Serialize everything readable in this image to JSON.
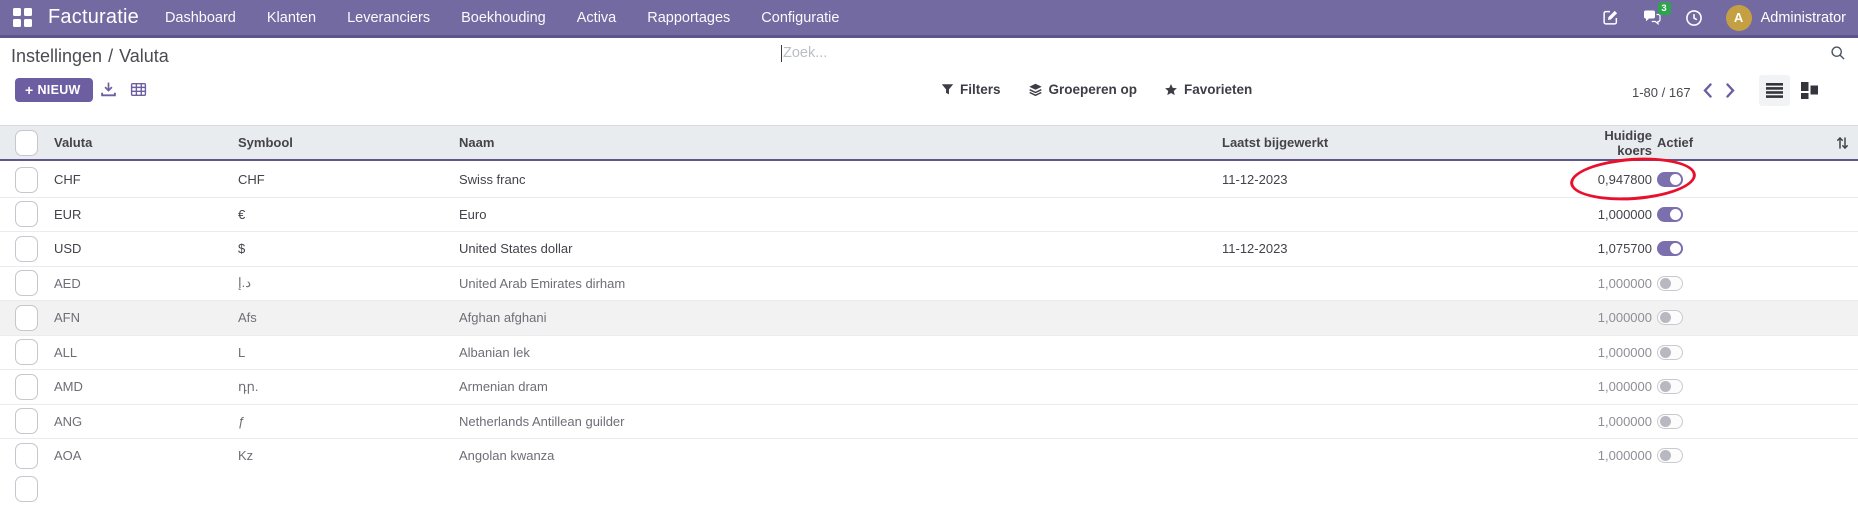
{
  "colors": {
    "navbar_bg": "#726AA1",
    "accent_purple": "#6D5EA2",
    "toggle_on_purple": "#7B6FAE",
    "badge_green": "#2EA44F",
    "avatar_gold": "#C5A042",
    "annotation_red": "#E8112D",
    "header_row_bg": "#E9ECEF"
  },
  "navbar": {
    "app_name": "Facturatie",
    "menu_items": [
      "Dashboard",
      "Klanten",
      "Leveranciers",
      "Boekhouding",
      "Activa",
      "Rapportages",
      "Configuratie"
    ],
    "message_count": "3",
    "user_initial": "A",
    "user_name": "Administrator"
  },
  "breadcrumb": {
    "parent": "Instellingen",
    "separator": "/",
    "current": "Valuta"
  },
  "search": {
    "placeholder": "Zoek..."
  },
  "toolbar": {
    "new_button": "NIEUW",
    "plus_sign": "+",
    "filters": "Filters",
    "group_by": "Groeperen op",
    "favorites": "Favorieten",
    "pager_text": "1-80 / 167"
  },
  "table": {
    "columns": {
      "valuta": "Valuta",
      "symbool": "Symbool",
      "naam": "Naam",
      "laatst_bijgewerkt": "Laatst bijgewerkt",
      "huidige_koers": "Huidige koers",
      "actief": "Actief"
    },
    "rows": [
      {
        "code": "CHF",
        "symbol": "CHF",
        "name": "Swiss franc",
        "updated": "11-12-2023",
        "rate": "0,947800",
        "active": true,
        "annotated": true
      },
      {
        "code": "EUR",
        "symbol": "€",
        "name": "Euro",
        "updated": "",
        "rate": "1,000000",
        "active": true
      },
      {
        "code": "USD",
        "symbol": "$",
        "name": "United States dollar",
        "updated": "11-12-2023",
        "rate": "1,075700",
        "active": true
      },
      {
        "code": "AED",
        "symbol": "د.إ",
        "name": "United Arab Emirates dirham",
        "updated": "",
        "rate": "1,000000",
        "active": false
      },
      {
        "code": "AFN",
        "symbol": "Afs",
        "name": "Afghan afghani",
        "updated": "",
        "rate": "1,000000",
        "active": false,
        "highlighted": true
      },
      {
        "code": "ALL",
        "symbol": "L",
        "name": "Albanian lek",
        "updated": "",
        "rate": "1,000000",
        "active": false
      },
      {
        "code": "AMD",
        "symbol": "դր.",
        "name": "Armenian dram",
        "updated": "",
        "rate": "1,000000",
        "active": false
      },
      {
        "code": "ANG",
        "symbol": "ƒ",
        "name": "Netherlands Antillean guilder",
        "updated": "",
        "rate": "1,000000",
        "active": false
      },
      {
        "code": "AOA",
        "symbol": "Kz",
        "name": "Angolan kwanza",
        "updated": "",
        "rate": "1,000000",
        "active": false
      }
    ]
  }
}
